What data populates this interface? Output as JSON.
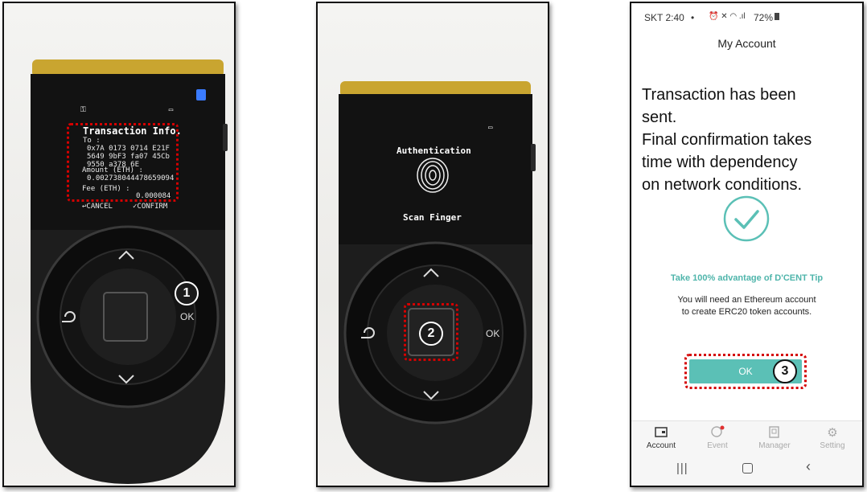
{
  "device_left": {
    "screen": {
      "title": "Transaction Info.",
      "to_label": "To :",
      "to_address": [
        "0x7A 0173 0714 E21F",
        "5649 9bF3 fa07 45Cb",
        "9550 a378 6E"
      ],
      "amount_label": "Amount (ETH) :",
      "amount_value": "0.002738044478659094",
      "fee_label": "Fee (ETH) :",
      "fee_value": "0.000084",
      "cancel_label": "↩CANCEL",
      "confirm_label": "✓CONFIRM"
    },
    "ok_label": "OK",
    "step_badge": "1"
  },
  "device_middle": {
    "screen": {
      "title": "Authentication",
      "instruction": "Scan Finger"
    },
    "ok_label": "OK",
    "step_badge": "2"
  },
  "phone": {
    "status": {
      "carrier_time": "SKT 2:40",
      "dot": "•",
      "icons": "⏰ ✕ ◠ .ıl",
      "battery": "72%"
    },
    "header_title": "My Account",
    "message": [
      "Transaction has been",
      "sent.",
      "Final confirmation takes",
      "time with dependency",
      "on network conditions."
    ],
    "tip_title": "Take 100% advantage of D'CENT Tip",
    "tip_text": [
      "You will need an Ethereum account",
      "to create ERC20 token accounts."
    ],
    "ok_button_label": "OK",
    "step_badge": "3",
    "tabs": [
      {
        "label": "Account",
        "icon": "wallet-icon"
      },
      {
        "label": "Event",
        "icon": "event-icon"
      },
      {
        "label": "Manager",
        "icon": "manager-icon"
      },
      {
        "label": "Setting",
        "icon": "gear-icon"
      }
    ],
    "colors": {
      "accent": "#5bc0b6",
      "tip": "#4fb5ab",
      "active_tab": "#333333",
      "inactive_tab": "#aaaaaa"
    }
  }
}
